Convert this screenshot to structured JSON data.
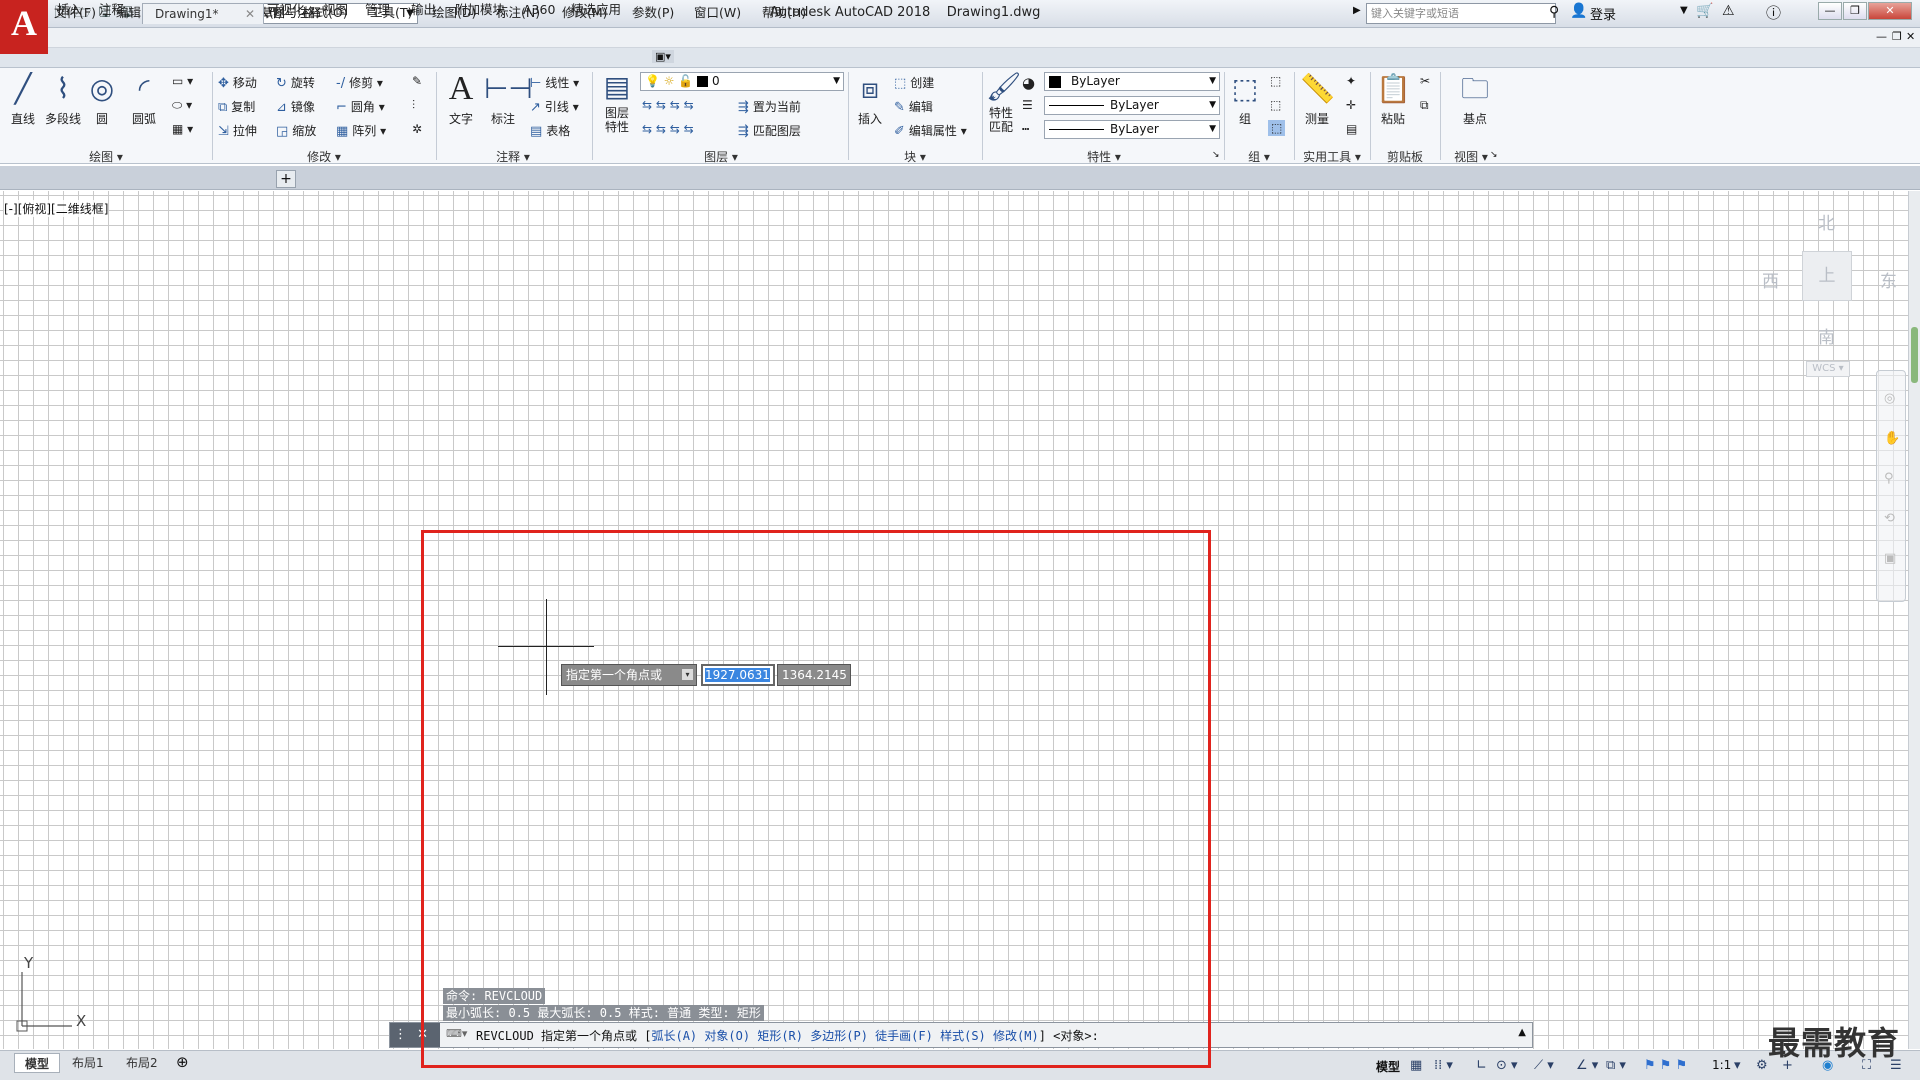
{
  "app": {
    "logo_letter": "A",
    "title": "Autodesk AutoCAD 2018",
    "document": "Drawing1.dwg",
    "workspace": "草图与注释",
    "search_placeholder": "键入关键字或短语",
    "login": "登录"
  },
  "menus": [
    "文件(F)",
    "编辑(E)",
    "视图(V)",
    "插入(I)",
    "格式(O)",
    "工具(T)",
    "绘图(D)",
    "标注(N)",
    "修改(M)",
    "参数(P)",
    "窗口(W)",
    "帮助(H)"
  ],
  "ribbon_tabs": [
    "默认",
    "插入",
    "注释",
    "参数化",
    "三维工具",
    "可视化",
    "视图",
    "管理",
    "输出",
    "附加模块",
    "A360",
    "精选应用"
  ],
  "ribbon": {
    "draw": {
      "line": "直线",
      "polyline": "多段线",
      "circle": "圆",
      "arc": "圆弧",
      "title": "绘图"
    },
    "modify": {
      "move": "移动",
      "rotate": "旋转",
      "trim": "修剪",
      "copy": "复制",
      "mirror": "镜像",
      "fillet": "圆角",
      "stretch": "拉伸",
      "scale": "缩放",
      "array": "阵列",
      "title": "修改"
    },
    "annotation": {
      "text": "文字",
      "dimension": "标注",
      "linear": "线性",
      "leader": "引线",
      "table": "表格",
      "title": "注释"
    },
    "layers": {
      "properties": "图层\n特性",
      "layer_value": "0",
      "set_current": "置为当前",
      "match_layer": "匹配图层",
      "title": "图层"
    },
    "block": {
      "insert": "插入",
      "create": "创建",
      "edit": "编辑",
      "edit_attr": "编辑属性",
      "title": "块"
    },
    "properties": {
      "match": "特性\n匹配",
      "color": "ByLayer",
      "linetype": "ByLayer",
      "lineweight": "ByLayer",
      "title": "特性"
    },
    "groups": {
      "group": "组",
      "title": "组"
    },
    "utilities": {
      "measure": "测量",
      "title": "实用工具"
    },
    "clipboard": {
      "paste": "粘贴",
      "title": "剪贴板"
    },
    "view": {
      "base": "基点",
      "title": "视图"
    }
  },
  "file_tabs": [
    "开始",
    "Drawing1*"
  ],
  "viewport_label": "[-][俯视][二维线框]",
  "viewcube": {
    "north": "北",
    "south": "南",
    "east": "东",
    "west": "西",
    "top": "上",
    "wcs": "WCS"
  },
  "dynamic_input": {
    "prompt": "指定第一个角点或",
    "x": "1927.0631",
    "y": "1364.2145"
  },
  "command_history": [
    "命令: REVCLOUD",
    "最小弧长: 0.5   最大弧长: 0.5   样式: 普通   类型: 矩形"
  ],
  "command_line": {
    "prefix": "REVCLOUD 指定第一个角点或 [",
    "options": [
      "弧长(A)",
      "对象(O)",
      "矩形(R)",
      "多边形(P)",
      "徒手画(F)",
      "样式(S)",
      "修改(M)"
    ],
    "suffix": "] <对象>:"
  },
  "layout_tabs": [
    "模型",
    "布局1",
    "布局2"
  ],
  "status": {
    "model": "模型",
    "scale": "1:1"
  },
  "ucs": {
    "x": "X",
    "y": "Y"
  },
  "watermark": "最需教育",
  "colors": {
    "accent_red": "#e0231d",
    "app_red": "#c8231f",
    "highlight": "#3b86e0"
  }
}
